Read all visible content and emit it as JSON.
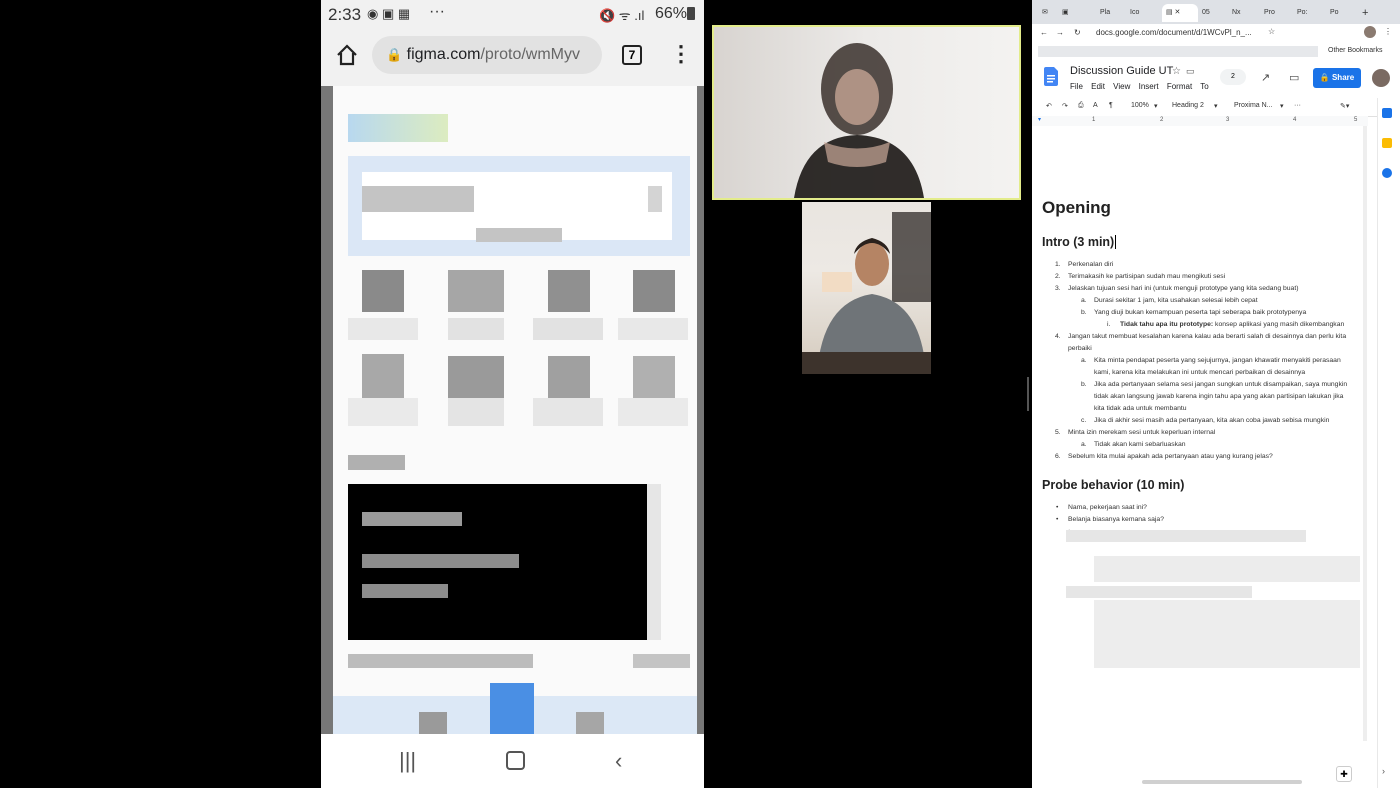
{
  "phone": {
    "status": {
      "time": "2:33",
      "more": "···",
      "battery": "66%"
    },
    "url": {
      "host": "figma.com",
      "path": "/proto/wmMyv",
      "tab_count": "7"
    }
  },
  "docs": {
    "tabs": [
      "Pla",
      "Ico",
      "05",
      "Nx",
      "Pro",
      "Po:",
      "Po"
    ],
    "address": "docs.google.com/document/d/1WCvPl_n_...",
    "bookmarks_label": "Other Bookmarks",
    "title": "Discussion Guide UT",
    "menu": [
      "File",
      "Edit",
      "View",
      "Insert",
      "Format",
      "To"
    ],
    "share_label": "Share",
    "comment_count": "2",
    "toolbar": {
      "zoom": "100%",
      "style": "Heading 2",
      "font": "Proxima N..."
    },
    "content": {
      "heading1": "Opening",
      "section_intro": "Intro (3 min)",
      "intro_items": [
        {
          "n": "1.",
          "t": "Perkenalan diri"
        },
        {
          "n": "2.",
          "t": "Terimakasih ke partisipan sudah mau mengikuti sesi"
        },
        {
          "n": "3.",
          "t": "Jelaskan tujuan sesi hari ini (untuk menguji prototype yang kita sedang buat)"
        },
        {
          "n": "a.",
          "t": "Durasi sekitar 1 jam, kita usahakan selesai lebih cepat"
        },
        {
          "n": "b.",
          "t": "Yang diuji bukan kemampuan peserta tapi seberapa baik prototypenya"
        },
        {
          "n": "i.",
          "bold": "Tidak tahu apa itu prototype:",
          "t": " konsep aplikasi yang masih dikembangkan"
        },
        {
          "n": "4.",
          "t": "Jangan takut membuat kesalahan karena kalau ada berarti salah di desainnya dan perlu kita"
        },
        {
          "n": "",
          "t": "perbaiki"
        },
        {
          "n": "a.",
          "t": "Kita minta pendapat peserta yang sejujurnya, jangan khawatir menyakiti perasaan"
        },
        {
          "n": "",
          "t": "kami, karena kita melakukan ini untuk mencari perbaikan di desainnya"
        },
        {
          "n": "b.",
          "t": "Jika ada pertanyaan selama sesi jangan sungkan untuk disampaikan, saya mungkin"
        },
        {
          "n": "",
          "t": "tidak akan langsung jawab karena ingin tahu apa yang akan partisipan lakukan jika"
        },
        {
          "n": "",
          "t": "kita tidak ada untuk membantu"
        },
        {
          "n": "c.",
          "t": "Jika di akhir sesi masih ada pertanyaan, kita akan coba jawab sebisa mungkin"
        },
        {
          "n": "5.",
          "t": "Minta izin merekam sesi untuk keperluan internal"
        },
        {
          "n": "a.",
          "t": "Tidak akan kami sebarluaskan"
        },
        {
          "n": "6.",
          "t": "Sebelum kita mulai apakah ada pertanyaan atau yang kurang jelas?"
        }
      ],
      "section_probe": "Probe behavior (10 min)",
      "probe_items": [
        {
          "n": "•",
          "t": "Nama, pekerjaan saat ini?"
        },
        {
          "n": "•",
          "t": "Belanja biasanya kemana saja?"
        }
      ]
    }
  }
}
